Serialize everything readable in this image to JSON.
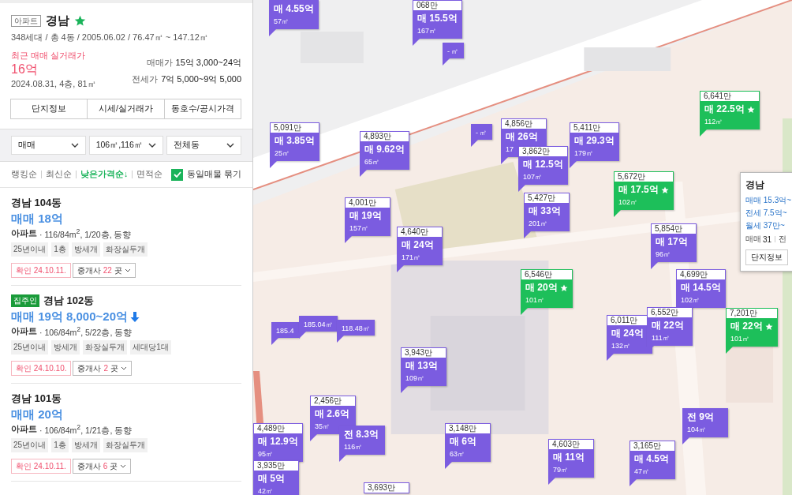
{
  "complex": {
    "badge": "아파트",
    "title": "경남",
    "starred": true,
    "summary": "348세대 / 총 4동 / 2005.06.02 / 76.47㎡ ~ 147.12㎡",
    "recent_label": "최근 매매 실거래가",
    "recent_price": "16억",
    "recent_detail": "2024.08.31, 4층, 81㎡",
    "ranges": [
      {
        "label": "매매가",
        "value": "15억 3,000~24억"
      },
      {
        "label": "전세가",
        "value": "7억 5,000~9억 5,000"
      }
    ],
    "tabs": [
      "단지정보",
      "시세/실거래가",
      "동호수/공시가격"
    ]
  },
  "filters": [
    "매매",
    "106㎡,116㎡",
    "전체동"
  ],
  "sort": [
    {
      "label": "랭킹순",
      "selected": false
    },
    {
      "label": "최신순",
      "selected": false
    },
    {
      "label": "낮은가격순↓",
      "selected": true
    },
    {
      "label": "면적순",
      "selected": false
    }
  ],
  "group_same": {
    "label": "동일매물 묶기",
    "checked": true
  },
  "listings": [
    {
      "title": "경남 104동",
      "price": "매매 18억",
      "price_drop": false,
      "type": "아파트",
      "spec": "· 116/84m$^{2}$, 1/20층, 동향",
      "tags": [
        "25년이내",
        "1층",
        "방세개",
        "화장실두개"
      ],
      "confirmed": "확인 24.10.11.",
      "agents": "중개사",
      "agent_count": "22",
      "agent_unit": "곳"
    },
    {
      "title": "경남 102동",
      "owner_badge": "집주인",
      "price": "매매 19억 8,000~20억",
      "price_drop": true,
      "type": "아파트",
      "spec": "· 106/84m$^{2}$, 5/22층, 동향",
      "tags": [
        "25년이내",
        "방세개",
        "화장실두개",
        "세대당1대"
      ],
      "confirmed": "확인 24.10.10.",
      "agents": "중개사",
      "agent_count": "2",
      "agent_unit": "곳"
    },
    {
      "title": "경남 101동",
      "price": "매매 20억",
      "price_drop": false,
      "type": "아파트",
      "spec": "· 106/84m$^{2}$, 1/21층, 동향",
      "tags": [
        "25년이내",
        "1층",
        "방세개",
        "화장실두개"
      ],
      "confirmed": "확인 24.10.11.",
      "agents": "중개사",
      "agent_count": "6",
      "agent_unit": "곳"
    }
  ],
  "map": {
    "kind": "picture",
    "markers": [
      {
        "price": "매 4.55억",
        "area": "57㎡",
        "color": "#7b5ce0",
        "star": false
      },
      {
        "unit": "068만",
        "price": "매 15.5억",
        "area": "167㎡",
        "color": "#7b5ce0",
        "star": false
      },
      {
        "area": "- ㎡",
        "color": "#7b5ce0",
        "star": false
      },
      {
        "unit": "6,641만",
        "price": "매 22.5억",
        "area": "112㎡",
        "color": "#1dbf5a",
        "star": true
      },
      {
        "unit": "5,091만",
        "price": "매 3.85억",
        "area": "25㎡",
        "color": "#7b5ce0",
        "star": false
      },
      {
        "unit": "4,893만",
        "price": "매 9.62억",
        "area": "65㎡",
        "color": "#7b5ce0",
        "star": false
      },
      {
        "area": "- ㎡",
        "color": "#7b5ce0",
        "star": false
      },
      {
        "unit": "4,856만",
        "price": "매 26억",
        "area": "17",
        "color": "#7b5ce0",
        "star": false
      },
      {
        "unit": "5,411만",
        "price": "매 29.3억",
        "area": "179㎡",
        "color": "#7b5ce0",
        "star": false
      },
      {
        "unit": "3,862만",
        "price": "매 12.5억",
        "area": "107㎡",
        "color": "#7b5ce0",
        "star": false
      },
      {
        "unit": "5,672만",
        "price": "매 17.5억",
        "area": "102㎡",
        "color": "#1dbf5a",
        "star": true
      },
      {
        "unit": "4,001만",
        "price": "매 19억",
        "area": "157㎡",
        "color": "#7b5ce0",
        "star": false
      },
      {
        "unit": "5,427만",
        "price": "매 33억",
        "area": "201㎡",
        "color": "#7b5ce0",
        "star": false
      },
      {
        "unit": "4,640만",
        "price": "매 24억",
        "area": "171㎡",
        "color": "#7b5ce0",
        "star": false
      },
      {
        "unit": "5,854만",
        "price": "매 17억",
        "area": "96㎡",
        "color": "#7b5ce0",
        "star": false
      },
      {
        "unit": "6,546만",
        "price": "매 20억",
        "area": "101㎡",
        "color": "#1dbf5a",
        "star": true
      },
      {
        "unit": "4,699만",
        "price": "매 14.5억",
        "area": "102㎡",
        "color": "#7b5ce0",
        "star": false
      },
      {
        "area": "185.4",
        "color": "#7b5ce0",
        "star": false
      },
      {
        "area": "185.04㎡",
        "color": "#7b5ce0",
        "star": false
      },
      {
        "area": "118.48㎡",
        "color": "#7b5ce0",
        "star": false
      },
      {
        "unit": "6,011만",
        "price": "매 24억",
        "area": "132㎡",
        "color": "#7b5ce0",
        "star": false
      },
      {
        "unit": "6,552만",
        "price": "매 22억",
        "area": "111㎡",
        "color": "#7b5ce0",
        "star": false
      },
      {
        "unit": "7,201만",
        "price": "매 22억",
        "area": "101㎡",
        "color": "#1dbf5a",
        "star": true
      },
      {
        "unit": "3,943만",
        "price": "매 13억",
        "area": "109㎡",
        "color": "#7b5ce0",
        "star": false
      },
      {
        "unit": "2,456만",
        "price": "매 2.6억",
        "area": "35㎡",
        "color": "#7b5ce0",
        "star": false
      },
      {
        "unit": "4,489만",
        "price": "매 12.9억",
        "area": "95㎡",
        "color": "#7b5ce0",
        "star": false
      },
      {
        "price": "전 8.3억",
        "area": "116㎡",
        "color": "#7b5ce0",
        "star": false
      },
      {
        "unit": "3,148만",
        "price": "매 6억",
        "area": "63㎡",
        "color": "#7b5ce0",
        "star": false
      },
      {
        "price": "전 9억",
        "area": "104㎡",
        "color": "#7b5ce0",
        "star": false
      },
      {
        "unit": "4,603만",
        "price": "매 11억",
        "area": "79㎡",
        "color": "#7b5ce0",
        "star": false
      },
      {
        "unit": "3,165만",
        "price": "매 4.5억",
        "area": "47㎡",
        "color": "#7b5ce0",
        "star": false
      },
      {
        "unit": "3,935만",
        "price": "매 5억",
        "area": "42㎡",
        "color": "#7b5ce0",
        "star": false
      },
      {
        "unit": "3,693만",
        "color": "#7b5ce0",
        "star": false
      }
    ],
    "popup": {
      "title": "경남",
      "lines": [
        "매매 15.3억~",
        "전세 7.5억~",
        "월세 37만~"
      ],
      "count_label": "매매",
      "count": "31",
      "next": "전",
      "button": "단지정보"
    }
  }
}
